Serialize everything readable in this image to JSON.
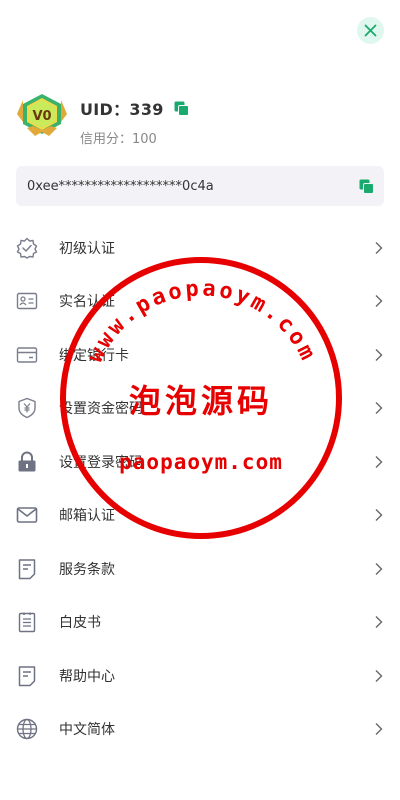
{
  "header": {
    "close_icon": "close-icon"
  },
  "profile": {
    "badge_level": "V0",
    "uid_text": "UID：339",
    "credit_text": "信用分：100"
  },
  "address": {
    "value": "0xee*******************0c4a"
  },
  "menu": {
    "items": [
      {
        "label": "初级认证",
        "icon": "shield-check-icon"
      },
      {
        "label": "实名认证",
        "icon": "id-card-icon"
      },
      {
        "label": "绑定银行卡",
        "icon": "bank-card-icon"
      },
      {
        "label": "设置资金密码",
        "icon": "yen-shield-icon"
      },
      {
        "label": "设置登录密码",
        "icon": "lock-icon"
      },
      {
        "label": "邮箱认证",
        "icon": "mail-icon"
      },
      {
        "label": "服务条款",
        "icon": "document-icon"
      },
      {
        "label": "白皮书",
        "icon": "clipboard-icon"
      },
      {
        "label": "帮助中心",
        "icon": "help-document-icon"
      },
      {
        "label": "中文简体",
        "icon": "globe-icon"
      }
    ]
  },
  "watermark": {
    "arc_text": "www.paopaoym.com",
    "center_text": "泡泡源码",
    "bottom_text": "paopaoym.com"
  },
  "colors": {
    "accent": "#1aaa6e",
    "stamp": "#e60000"
  }
}
